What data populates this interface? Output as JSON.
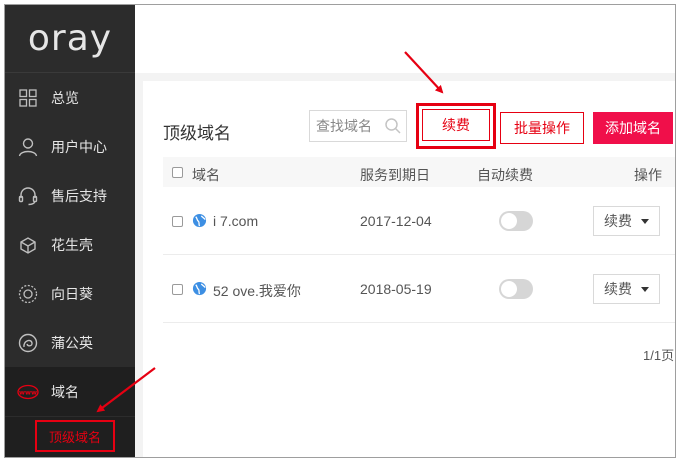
{
  "brand": {
    "logo_text": "oray"
  },
  "sidebar": {
    "items": [
      {
        "label": "总览",
        "icon": "grid-icon"
      },
      {
        "label": "用户中心",
        "icon": "user-icon"
      },
      {
        "label": "售后支持",
        "icon": "headset-icon"
      },
      {
        "label": "花生壳",
        "icon": "peanut-shell-icon"
      },
      {
        "label": "向日葵",
        "icon": "sunflower-icon"
      },
      {
        "label": "蒲公英",
        "icon": "dandelion-icon"
      },
      {
        "label": "域名",
        "icon": "www-icon"
      }
    ],
    "sub_items": [
      {
        "label": "顶级域名"
      }
    ]
  },
  "main": {
    "title": "顶级域名",
    "search": {
      "placeholder": "查找域名"
    },
    "buttons": {
      "renew": "续费",
      "batch": "批量操作",
      "add": "添加域名"
    },
    "table": {
      "headers": {
        "domain": "域名",
        "expiry": "服务到期日",
        "auto_renew": "自动续费",
        "action": "操作"
      },
      "rows": [
        {
          "domain": "i   7.com",
          "expiry": "2017-12-04",
          "auto_renew": false,
          "action": "续费"
        },
        {
          "domain": "52   ove.我爱你",
          "expiry": "2018-05-19",
          "auto_renew": false,
          "action": "续费"
        }
      ]
    },
    "pagination": "1/1页"
  },
  "colors": {
    "accent": "#e60012",
    "add_button": "#f00f4a",
    "sidebar_bg": "#2c2c2c",
    "annotation": "#e60012"
  }
}
